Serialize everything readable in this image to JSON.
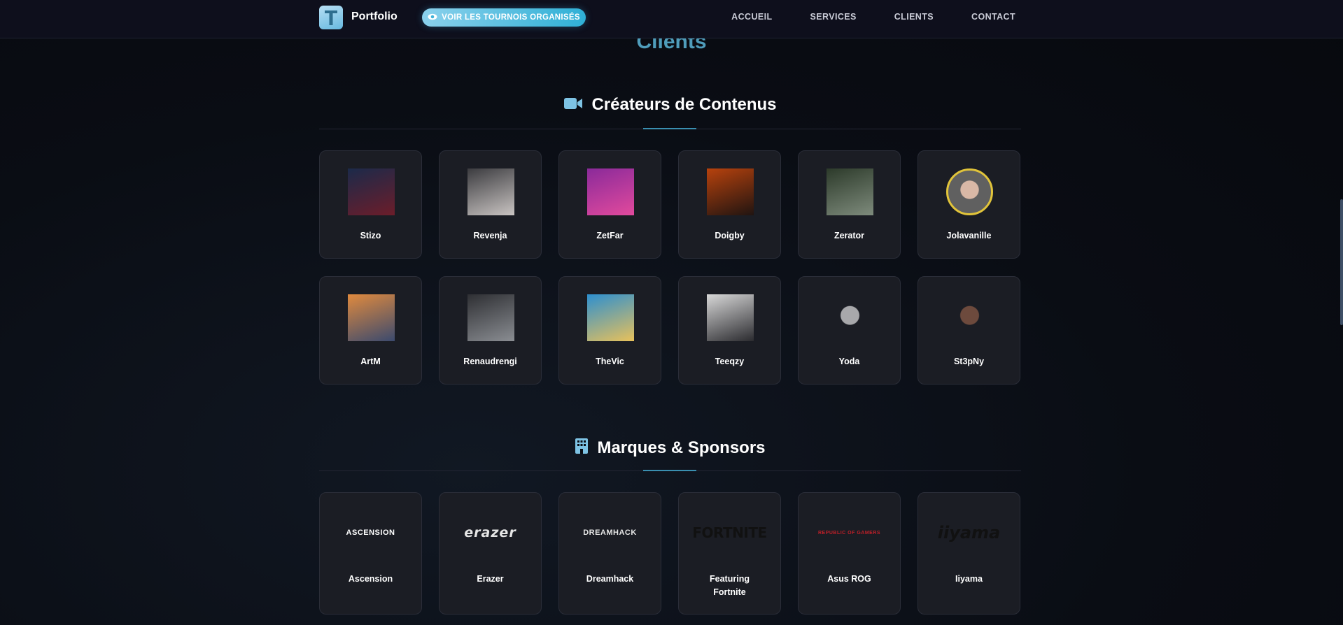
{
  "nav": {
    "brand": "Portfolio",
    "cta_label": "VOIR LES TOURNOIS ORGANISÉS",
    "menu": [
      "ACCUEIL",
      "SERVICES",
      "CLIENTS",
      "CONTACT"
    ]
  },
  "page": {
    "title": "Clients"
  },
  "creators": {
    "title": "Créateurs de Contenus",
    "items": [
      {
        "name": "Stizo",
        "colors": [
          "#1b2a4a",
          "#6c1d2a"
        ]
      },
      {
        "name": "Revenja",
        "colors": [
          "#3b3b3f",
          "#c9c4c2"
        ]
      },
      {
        "name": "ZetFar",
        "colors": [
          "#8a2a9a",
          "#e24a9d"
        ]
      },
      {
        "name": "Doigby",
        "colors": [
          "#b7420d",
          "#201411"
        ]
      },
      {
        "name": "Zerator",
        "colors": [
          "#2c3a2a",
          "#7e8b7c"
        ]
      },
      {
        "name": "Jolavanille",
        "colors": [
          "#e1c43a",
          "#606060"
        ]
      },
      {
        "name": "ArtM",
        "colors": [
          "#e08a3e",
          "#3b4a6e"
        ]
      },
      {
        "name": "Renaudrengi",
        "colors": [
          "#2e2f33",
          "#8a8d92"
        ]
      },
      {
        "name": "TheVic",
        "colors": [
          "#2d8fcf",
          "#e8c15b"
        ]
      },
      {
        "name": "Teeqzy",
        "colors": [
          "#d8d8d8",
          "#2b2b2f"
        ]
      },
      {
        "name": "Yoda",
        "colors": [
          "#1b1d24",
          "#a8a8ab"
        ]
      },
      {
        "name": "St3pNy",
        "colors": [
          "#1b1d24",
          "#6d4a3d"
        ]
      }
    ]
  },
  "brands": {
    "title": "Marques & Sponsors",
    "items": [
      {
        "name": "Ascension",
        "logo_text": "ASCENSION",
        "logo_color": "#ffffff"
      },
      {
        "name": "Erazer",
        "logo_text": "erazer",
        "logo_color": "#e6e6e6"
      },
      {
        "name": "Dreamhack",
        "logo_text": "DREAMHACK",
        "logo_color": "#e6e6e6"
      },
      {
        "name": "Featuring Fortnite",
        "logo_text": "FORTNITE",
        "logo_color": "#111111"
      },
      {
        "name": "Asus ROG",
        "logo_text": "REPUBLIC OF GAMERS",
        "logo_color": "#c01f28"
      },
      {
        "name": "Iiyama",
        "logo_text": "iiyama",
        "logo_color": "#111111"
      }
    ]
  }
}
